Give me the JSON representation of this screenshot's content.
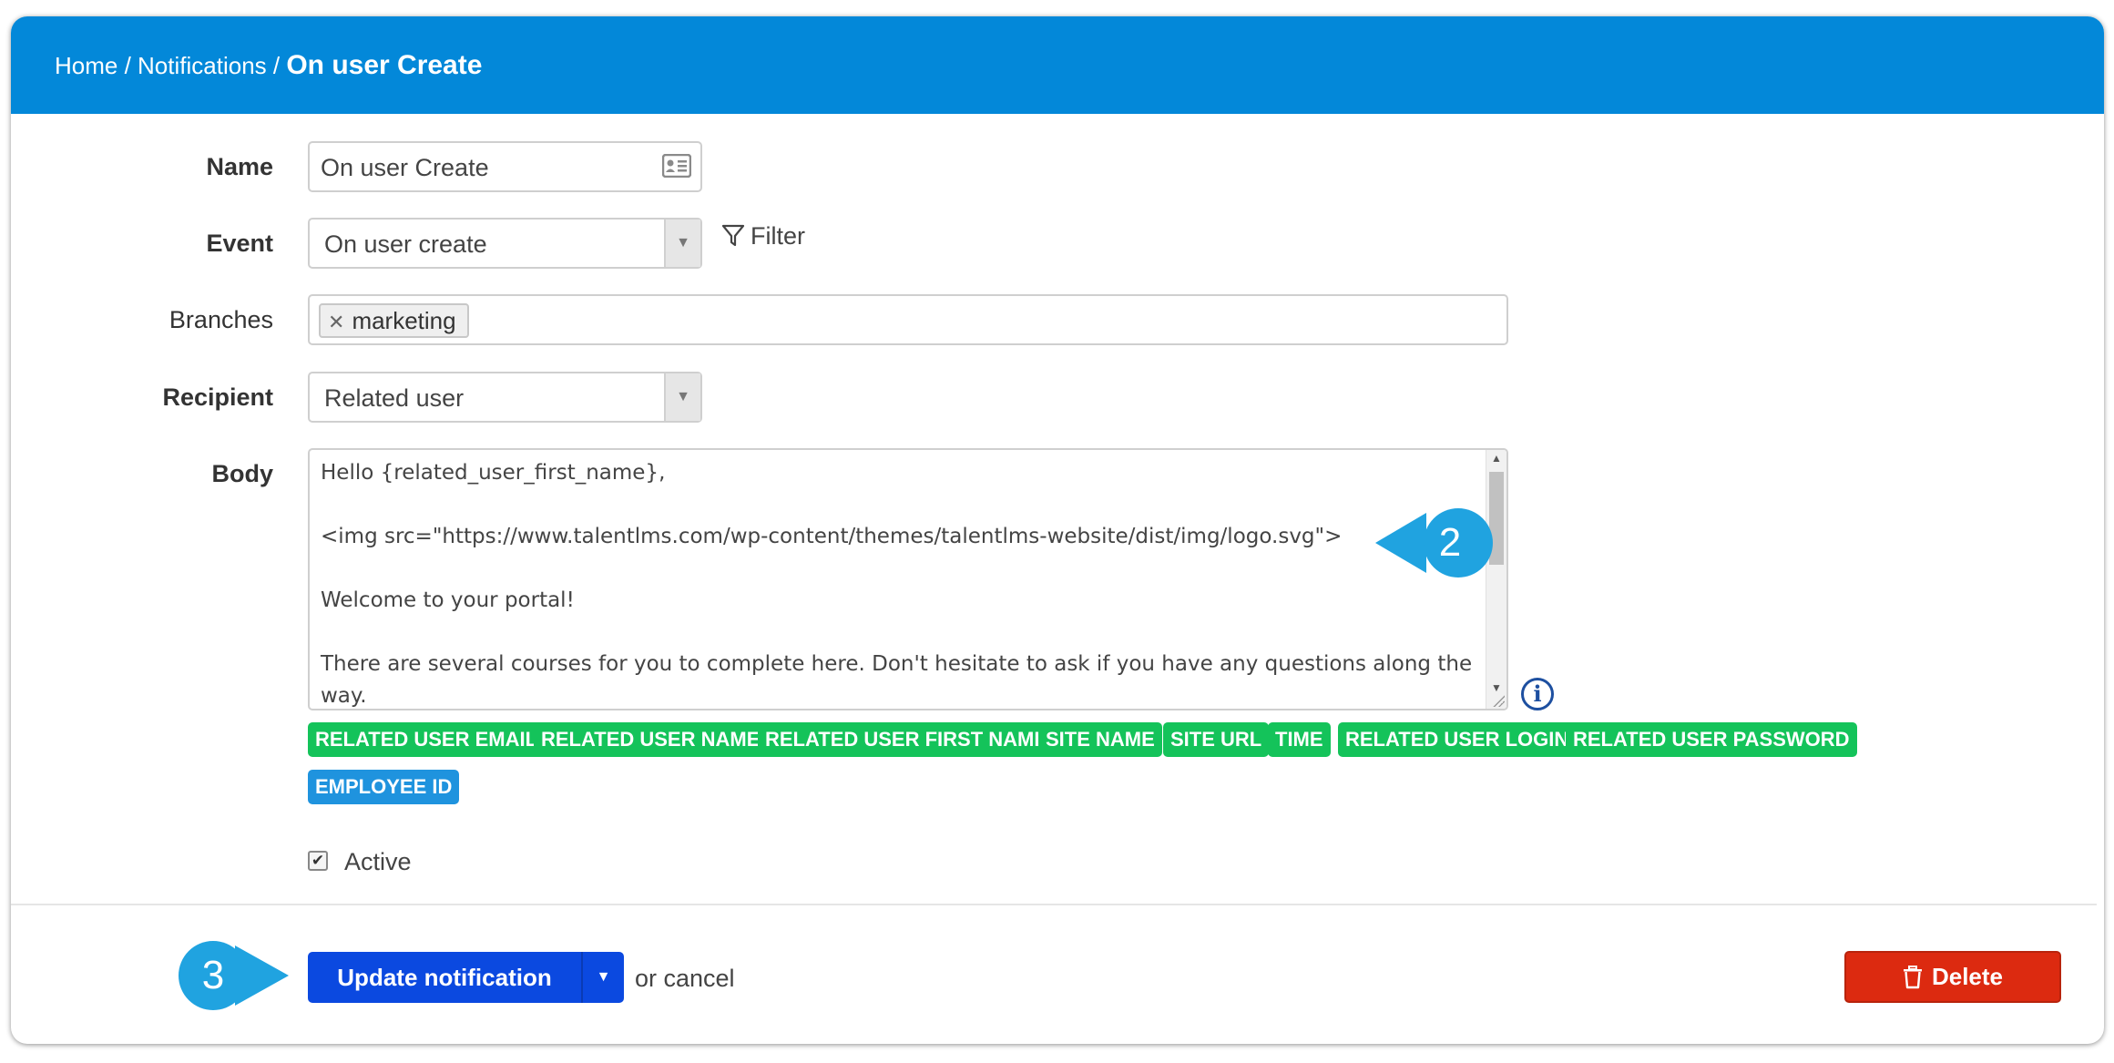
{
  "breadcrumb": {
    "home": "Home",
    "sep1": " / ",
    "notifications": "Notifications",
    "sep2": " / ",
    "current": "On user Create"
  },
  "form": {
    "name_label": "Name",
    "name_value": "On user Create",
    "event_label": "Event",
    "event_value": "On user create",
    "filter_label": "Filter",
    "branches_label": "Branches",
    "branch_tags": [
      "marketing"
    ],
    "recipient_label": "Recipient",
    "recipient_value": "Related user",
    "body_label": "Body",
    "body_lines": [
      "Hello {related_user_first_name},",
      "",
      "<img src=\"https://www.talentlms.com/wp-content/themes/talentlms-website/dist/img/logo.svg\">",
      "",
      "Welcome to your portal!",
      "",
      "There are several courses for you to complete here. Don't hesitate to ask if you have any questions along the",
      "way."
    ],
    "info_glyph": "i",
    "placeholders": [
      "RELATED USER EMAIL",
      "RELATED USER NAME",
      "RELATED USER FIRST NAME",
      "SITE NAME",
      "SITE URL",
      "TIME",
      "RELATED USER LOGIN",
      "RELATED USER PASSWORD"
    ],
    "custom_placeholders": [
      "EMPLOYEE ID"
    ],
    "active_label": "Active",
    "active_checked": true
  },
  "actions": {
    "update_label": "Update notification",
    "cancel_text": "or cancel",
    "delete_label": "Delete"
  },
  "callouts": [
    "2",
    "3"
  ],
  "colors": {
    "header": "#0388d9",
    "placeholder_chip": "#14c35a",
    "custom_chip": "#1f93de",
    "primary_button": "#0b49e0",
    "delete_button": "#dc2a10",
    "callout": "#20a3e0"
  }
}
